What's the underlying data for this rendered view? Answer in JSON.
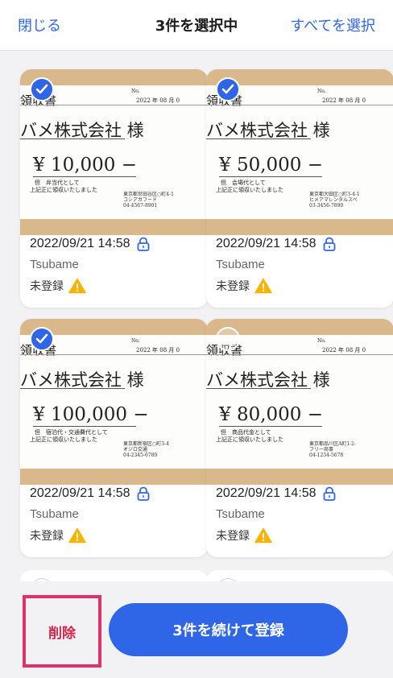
{
  "header": {
    "close_label": "閉じる",
    "title": "3件を選択中",
    "select_all_label": "すべてを選択"
  },
  "cards": [
    {
      "selected": true,
      "receipt": {
        "title": "領収書",
        "no_label": "No.",
        "date": "2022 年 08 月 0",
        "company": "バメ株式会社 様",
        "amount": "¥ 10,000 −",
        "purpose": "但　弁当代として",
        "received": "上記正に領収いたしました",
        "address": "東京都世田谷区○町4-1\nコシアガフード\n04-4567-8901"
      },
      "timestamp": "2022/09/21 14:58",
      "user": "Tsubame",
      "status": "未登録"
    },
    {
      "selected": true,
      "receipt": {
        "title": "領収書",
        "no_label": "No.",
        "date": "2022 年 08 月 0",
        "company": "バメ株式会社 様",
        "amount": "¥ 50,000 −",
        "purpose": "但　会場代として",
        "received": "上記正に領収いたしました",
        "address": "東京都大田区○町3-4-1\nヒメアマレンタルスペ\n03-3456-7890"
      },
      "timestamp": "2022/09/21 14:58",
      "user": "Tsubame",
      "status": "未登録"
    },
    {
      "selected": true,
      "receipt": {
        "title": "領収書",
        "no_label": "No.",
        "date": "2022 年 08 月 0",
        "company": "バメ株式会社 様",
        "amount": "¥ 100,000 −",
        "purpose": "但　宿泊代・交通費代として",
        "received": "上記正に領収いたしました",
        "address": "東京都新宿区○町3-4\nオジロ交通\n04-2345-6789"
      },
      "timestamp": "2022/09/21 14:58",
      "user": "Tsubame",
      "status": "未登録"
    },
    {
      "selected": false,
      "receipt": {
        "title": "領収書",
        "no_label": "No.",
        "date": "2022 年 08 月 0",
        "company": "バメ株式会社 様",
        "amount": "¥ 80,000 −",
        "purpose": "但　商品代金として",
        "received": "上記正に領収いたしました",
        "address": "東京都品川区A町1-2-\nフリー商事\n04-1234-5678"
      },
      "timestamp": "2022/09/21 14:58",
      "user": "Tsubame",
      "status": "未登録"
    }
  ],
  "footer": {
    "delete_label": "削除",
    "register_label": "3件を続けて登録"
  },
  "icons": {
    "check": "checkmark-icon",
    "lock": "lock-icon",
    "warning": "warning-icon"
  },
  "colors": {
    "accent": "#2f66e8",
    "delete_text": "#d8244b",
    "highlight_border": "#e0316e",
    "warning": "#f5b400"
  }
}
